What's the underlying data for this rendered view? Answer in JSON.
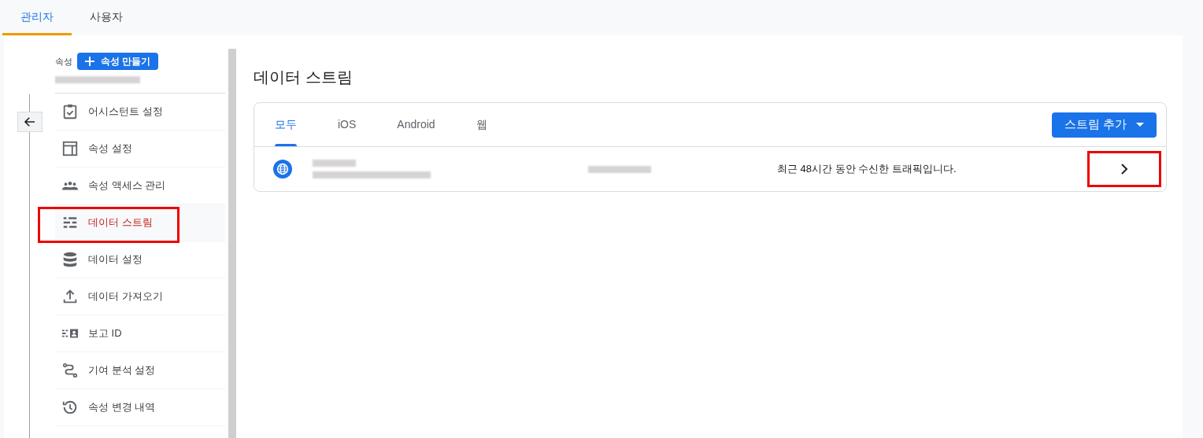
{
  "top_tabs": [
    {
      "label": "관리자",
      "selected": true
    },
    {
      "label": "사용자",
      "selected": false
    }
  ],
  "sidebar": {
    "section_label": "속성",
    "create_button": "속성 만들기",
    "items": [
      {
        "label": "어시스턴트 설정",
        "selected": false,
        "highlighted": false
      },
      {
        "label": "속성 설정",
        "selected": false,
        "highlighted": false
      },
      {
        "label": "속성 액세스 관리",
        "selected": false,
        "highlighted": false
      },
      {
        "label": "데이터 스트림",
        "selected": true,
        "highlighted": true
      },
      {
        "label": "데이터 설정",
        "selected": false,
        "highlighted": false
      },
      {
        "label": "데이터 가져오기",
        "selected": false,
        "highlighted": false
      },
      {
        "label": "보고 ID",
        "selected": false,
        "highlighted": false
      },
      {
        "label": "기여 분석 설정",
        "selected": false,
        "highlighted": false
      },
      {
        "label": "속성 변경 내역",
        "selected": false,
        "highlighted": false
      }
    ]
  },
  "main": {
    "title": "데이터 스트림",
    "tabs": [
      {
        "label": "모두",
        "selected": true
      },
      {
        "label": "iOS",
        "selected": false
      },
      {
        "label": "Android",
        "selected": false
      },
      {
        "label": "웹",
        "selected": false
      }
    ],
    "add_button": "스트림 추가",
    "streams": [
      {
        "status": "최근 48시간 동안 수신한 트래픽입니다.",
        "highlighted": true
      }
    ]
  }
}
